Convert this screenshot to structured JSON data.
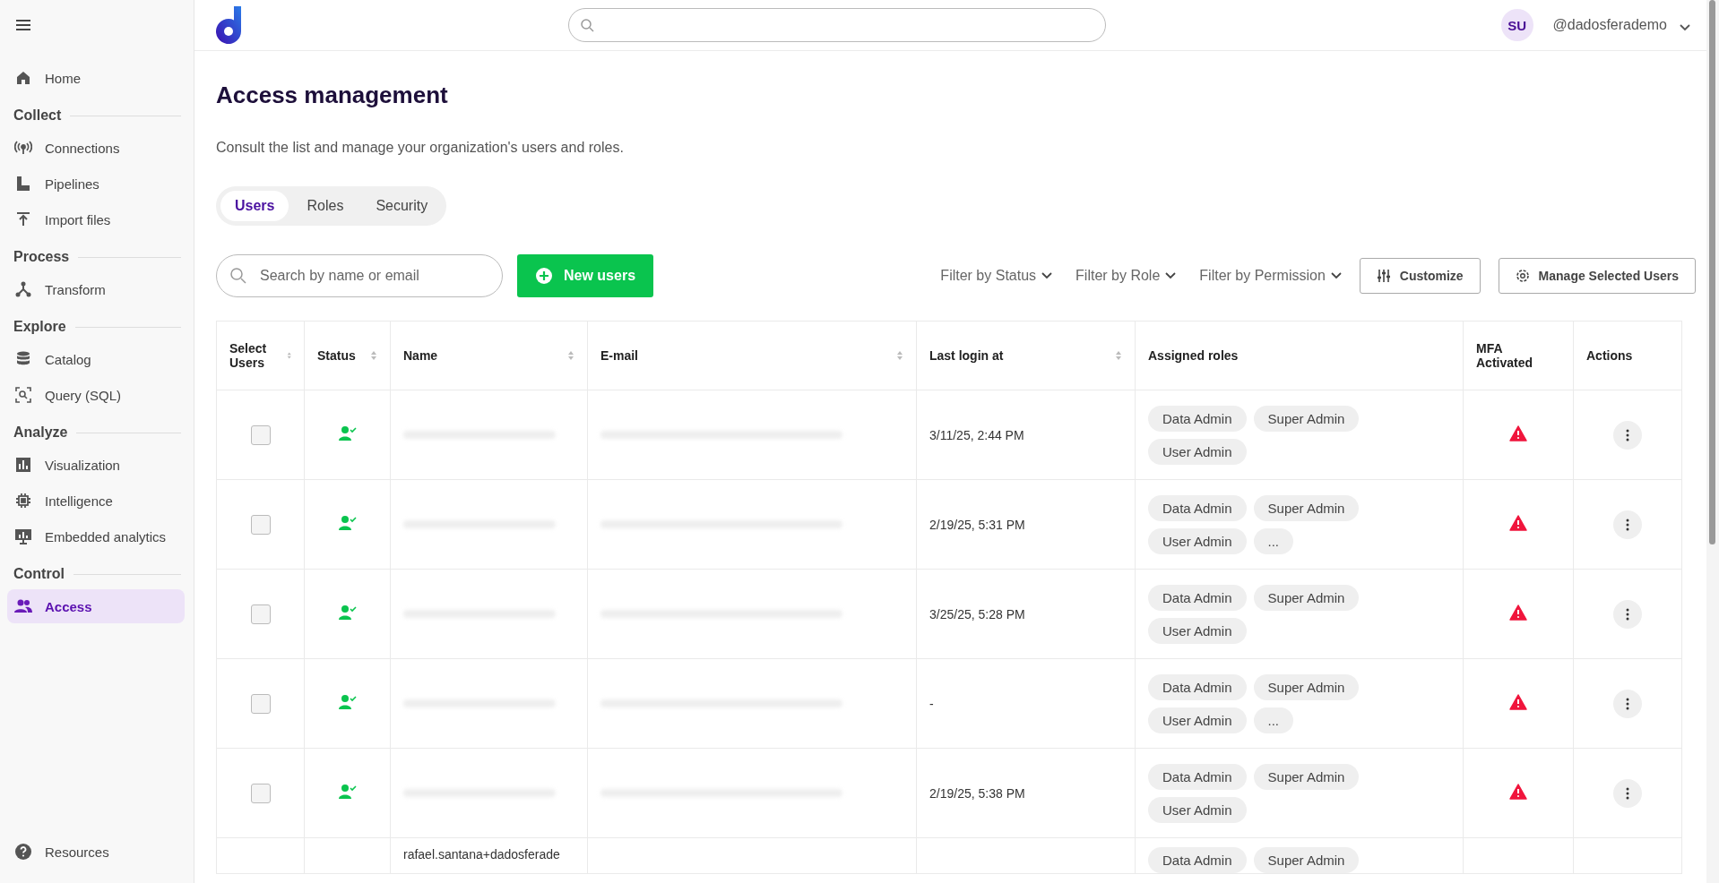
{
  "sidebar": {
    "sections": [
      {
        "items": [
          {
            "label": "Home",
            "selected": false
          }
        ]
      },
      {
        "title": "Collect",
        "items": [
          {
            "label": "Connections",
            "selected": false
          },
          {
            "label": "Pipelines",
            "selected": false
          },
          {
            "label": "Import files",
            "selected": false
          }
        ]
      },
      {
        "title": "Process",
        "items": [
          {
            "label": "Transform",
            "selected": false
          }
        ]
      },
      {
        "title": "Explore",
        "items": [
          {
            "label": "Catalog",
            "selected": false
          },
          {
            "label": "Query (SQL)",
            "selected": false
          }
        ]
      },
      {
        "title": "Analyze",
        "items": [
          {
            "label": "Visualization",
            "selected": false
          },
          {
            "label": "Intelligence",
            "selected": false
          },
          {
            "label": "Embedded analytics",
            "selected": false
          }
        ]
      },
      {
        "title": "Control",
        "items": [
          {
            "label": "Access",
            "selected": true
          }
        ]
      }
    ],
    "footer": {
      "label": "Resources"
    }
  },
  "header": {
    "avatar": "SU",
    "user": "@dadosferademo"
  },
  "page": {
    "title": "Access management",
    "subtitle": "Consult the list and manage your organization's users and roles."
  },
  "tabs": [
    {
      "label": "Users",
      "selected": true
    },
    {
      "label": "Roles",
      "selected": false
    },
    {
      "label": "Security",
      "selected": false
    }
  ],
  "toolbar": {
    "search_placeholder": "Search by name or email",
    "new_button": "New users",
    "filters": [
      "Filter by Status",
      "Filter by Role",
      "Filter by Permission"
    ],
    "customize": "Customize",
    "manage": "Manage Selected Users"
  },
  "table": {
    "columns": [
      {
        "label": "Select Users",
        "sortable": true
      },
      {
        "label": "Status",
        "sortable": true
      },
      {
        "label": "Name",
        "sortable": true
      },
      {
        "label": "E-mail",
        "sortable": true
      },
      {
        "label": "Last login at",
        "sortable": true
      },
      {
        "label": "Assigned roles",
        "sortable": false
      },
      {
        "label": "MFA Activated",
        "sortable": false
      },
      {
        "label": "Actions",
        "sortable": false
      }
    ],
    "rows": [
      {
        "checked": false,
        "active": true,
        "redacted": true,
        "last_login": "3/11/25, 2:44 PM",
        "roles": [
          "Data Admin",
          "Super Admin",
          "User Admin"
        ],
        "mfa": false
      },
      {
        "checked": false,
        "active": true,
        "redacted": true,
        "last_login": "2/19/25, 5:31 PM",
        "roles": [
          "Data Admin",
          "Super Admin",
          "User Admin",
          "..."
        ],
        "mfa": false
      },
      {
        "checked": false,
        "active": true,
        "redacted": true,
        "last_login": "3/25/25, 5:28 PM",
        "roles": [
          "Data Admin",
          "Super Admin",
          "User Admin"
        ],
        "mfa": false
      },
      {
        "checked": false,
        "active": true,
        "redacted": true,
        "last_login": "-",
        "roles": [
          "Data Admin",
          "Super Admin",
          "User Admin",
          "..."
        ],
        "mfa": false
      },
      {
        "checked": false,
        "active": true,
        "redacted": true,
        "last_login": "2/19/25, 5:38 PM",
        "roles": [
          "Data Admin",
          "Super Admin",
          "User Admin"
        ],
        "mfa": false
      },
      {
        "name": "rafael.santana+dadosferade",
        "roles": [
          "Data Admin",
          "Super Admin"
        ]
      }
    ]
  }
}
